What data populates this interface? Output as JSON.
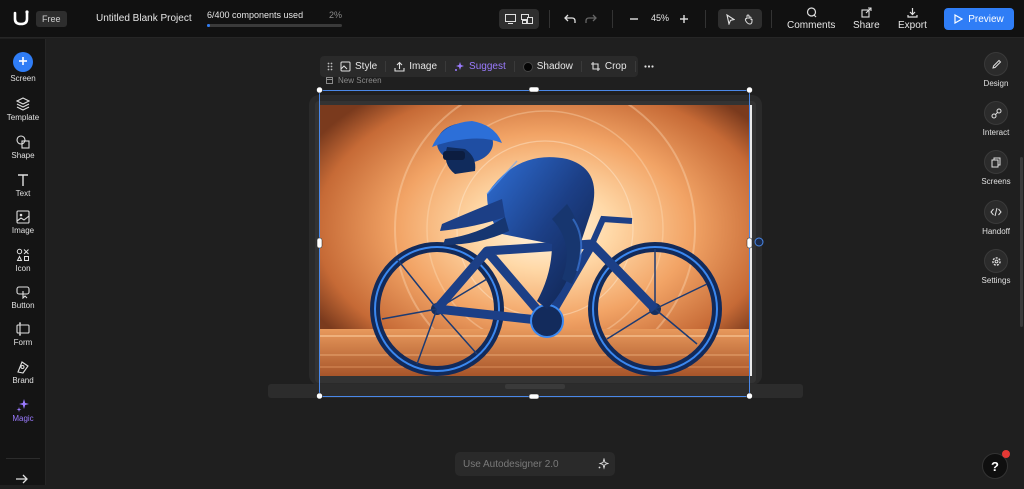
{
  "header": {
    "free_label": "Free",
    "project_title": "Untitled Blank Project",
    "components_used": "6/400 components used",
    "components_percent": "2%",
    "components_progress": 0.02,
    "zoom": "45%",
    "comments_label": "Comments",
    "share_label": "Share",
    "export_label": "Export",
    "preview_label": "Preview"
  },
  "sidebar": {
    "items": [
      {
        "label": "Screen",
        "icon": "plus-icon"
      },
      {
        "label": "Template",
        "icon": "layers-icon"
      },
      {
        "label": "Shape",
        "icon": "shapes-icon"
      },
      {
        "label": "Text",
        "icon": "text-icon"
      },
      {
        "label": "Image",
        "icon": "image-icon"
      },
      {
        "label": "Icon",
        "icon": "icon-set-icon"
      },
      {
        "label": "Button",
        "icon": "button-icon"
      },
      {
        "label": "Form",
        "icon": "form-icon"
      },
      {
        "label": "Brand",
        "icon": "brand-icon"
      },
      {
        "label": "Magic",
        "icon": "sparkle-icon"
      }
    ]
  },
  "context_toolbar": {
    "style_label": "Style",
    "image_label": "Image",
    "suggest_label": "Suggest",
    "shadow_label": "Shadow",
    "crop_label": "Crop"
  },
  "canvas": {
    "screen_name": "New Screen",
    "image_subject": "cyclist racing on a time-trial bicycle against an orange sunset"
  },
  "right_panel": {
    "items": [
      {
        "label": "Design",
        "icon": "pen-icon"
      },
      {
        "label": "Interact",
        "icon": "link-icon"
      },
      {
        "label": "Screens",
        "icon": "screens-icon"
      },
      {
        "label": "Handoff",
        "icon": "code-icon"
      },
      {
        "label": "Settings",
        "icon": "gear-icon"
      }
    ]
  },
  "autodesigner": {
    "placeholder": "Use Autodesigner 2.0"
  },
  "help": {
    "label": "?"
  },
  "colors": {
    "accent": "#2f7df6",
    "magic": "#9b7bff",
    "background": "#1f1f1f",
    "topbar": "#111111"
  }
}
